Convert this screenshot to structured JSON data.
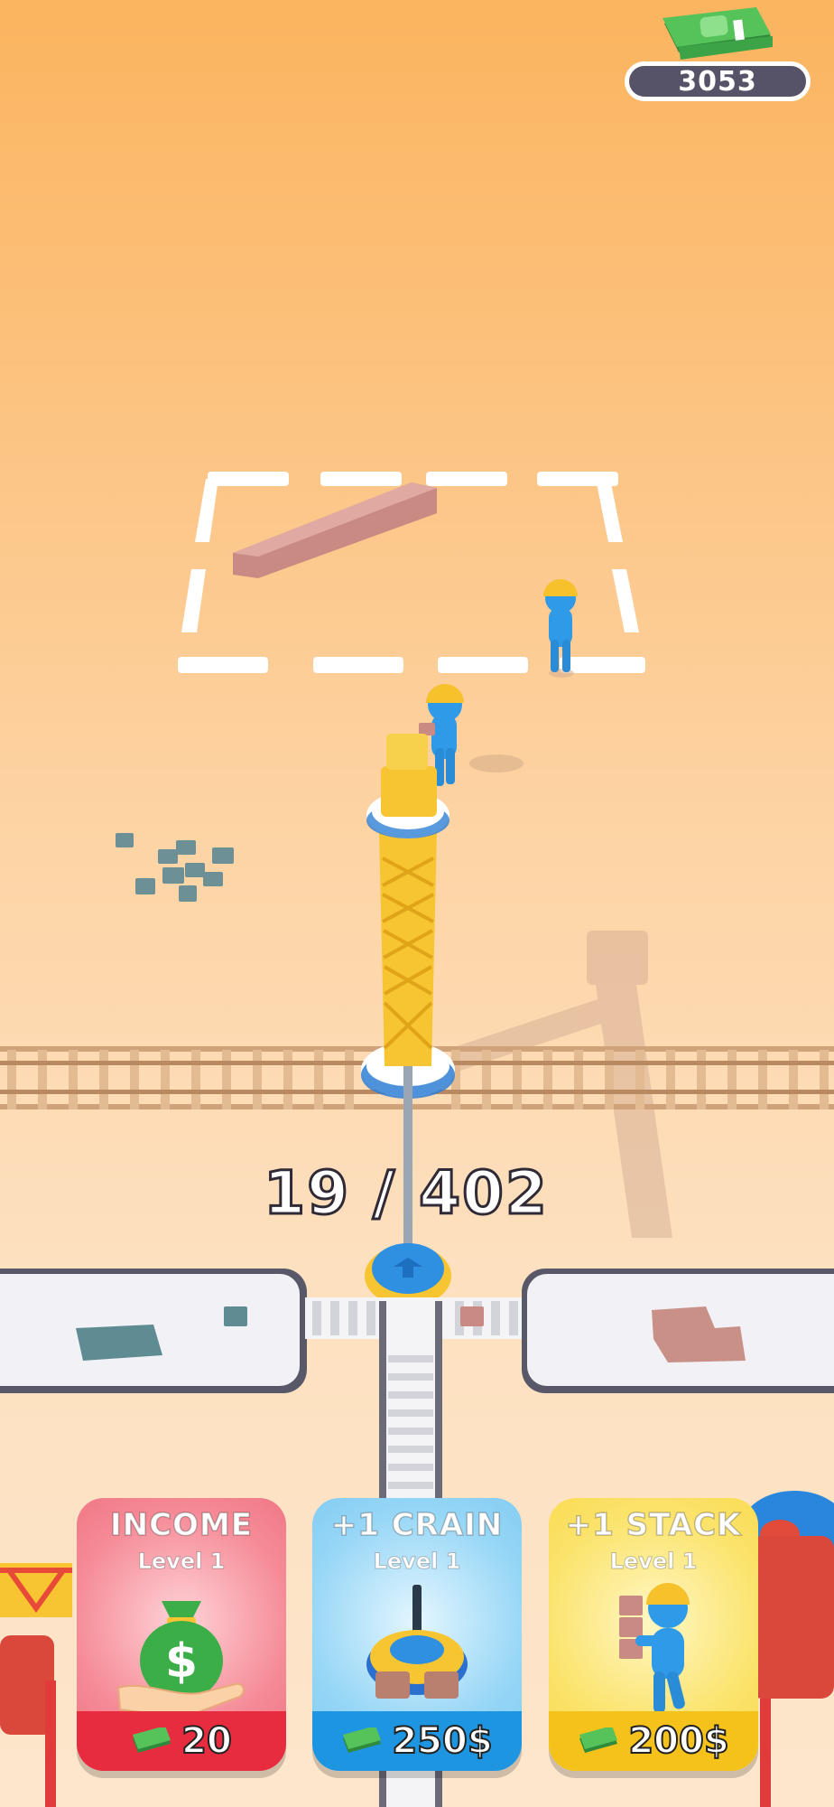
{
  "hud": {
    "money": "3053",
    "money_icon": "cash-stack-icon"
  },
  "progress": {
    "text": "19 / 402",
    "current": 19,
    "total": 402
  },
  "upgrades": [
    {
      "title": "INCOME",
      "level": "Level 1",
      "price": "20",
      "icon": "money-bag-hand-icon"
    },
    {
      "title": "+1 CRAIN",
      "level": "Level 1",
      "price": "250$",
      "icon": "crane-base-icon"
    },
    {
      "title": "+1 STACK",
      "level": "Level 1",
      "price": "200$",
      "icon": "worker-carrying-bricks-icon"
    }
  ],
  "colors": {
    "sky_top": "#fbb45f",
    "ground": "#fde6cc",
    "worker": "#2f9be8",
    "helmet": "#f6c12a",
    "crane": "#f7c531"
  }
}
